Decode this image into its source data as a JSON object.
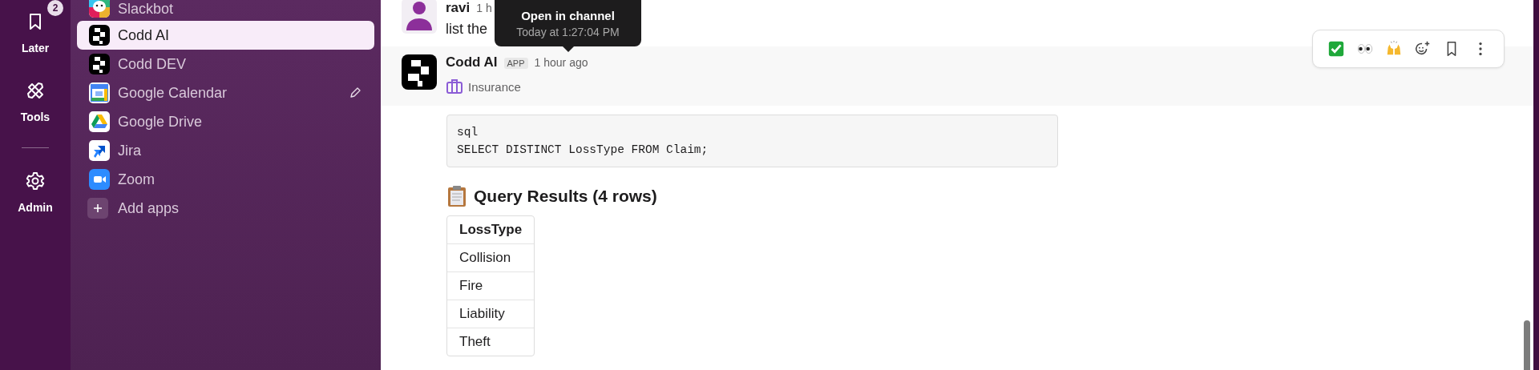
{
  "rail": [
    {
      "label": "Later",
      "badge": "2"
    },
    {
      "label": "Tools"
    },
    {
      "label": "Admin"
    }
  ],
  "sidebar": {
    "items": [
      {
        "label": "Slackbot",
        "kind": "app",
        "selected": false,
        "hovered": false
      },
      {
        "label": "Codd AI",
        "kind": "app",
        "selected": true,
        "hovered": false
      },
      {
        "label": "Codd DEV",
        "kind": "app",
        "selected": false,
        "hovered": false
      },
      {
        "label": "Google Calendar",
        "kind": "app",
        "selected": false,
        "hovered": true
      },
      {
        "label": "Google Drive",
        "kind": "app",
        "selected": false,
        "hovered": false
      },
      {
        "label": "Jira",
        "kind": "app",
        "selected": false,
        "hovered": false
      },
      {
        "label": "Zoom",
        "kind": "app",
        "selected": false,
        "hovered": false
      },
      {
        "label": "Add apps",
        "kind": "action",
        "selected": false,
        "hovered": false
      }
    ]
  },
  "messages": [
    {
      "author": "ravi",
      "time": "1 h",
      "text": "list the"
    },
    {
      "author": "Codd AI",
      "badge": "APP",
      "time": "1 hour ago",
      "context": "Insurance",
      "code": [
        "sql",
        "SELECT DISTINCT LossType FROM Claim;"
      ],
      "heading": "Query Results (4 rows)",
      "table": {
        "columns": [
          "LossType"
        ],
        "rows": [
          [
            "Collision"
          ],
          [
            "Fire"
          ],
          [
            "Liability"
          ],
          [
            "Theft"
          ]
        ]
      }
    }
  ],
  "tooltip": {
    "title": "Open in channel",
    "subtitle": "Today at 1:27:04 PM"
  }
}
